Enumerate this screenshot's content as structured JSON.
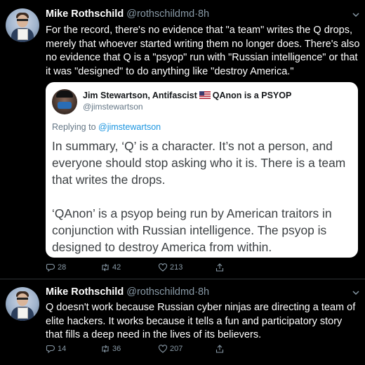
{
  "tweets": [
    {
      "author_name": "Mike Rothschild",
      "author_handle": "@rothschildmd",
      "separator": "·",
      "time": "8h",
      "text": "For the record, there's no evidence that \"a team\" writes the Q drops, merely that whoever started writing them no longer does. There's also no evidence that Q is a \"psyop\" run with \"Russian intelligence\" or that it was \"designed\" to do anything like \"destroy America.\"",
      "quoted": {
        "author_name": "Jim Stewartson, Antifascist",
        "author_suffix": "QAnon is a PSYOP",
        "author_handle": "@jimstewartson",
        "replying_label": "Replying to",
        "replying_handle": "@jimstewartson",
        "paragraphs": [
          "In summary, ‘Q’ is a character. It’s not a person, and everyone should stop asking who it is. There is a team that writes the drops.",
          "‘QAnon’ is a psyop being run by American traitors in conjunction with Russian intelligence. The psyop is designed to destroy America from within."
        ]
      },
      "actions": {
        "replies": "28",
        "retweets": "42",
        "likes": "213"
      }
    },
    {
      "author_name": "Mike Rothschild",
      "author_handle": "@rothschildmd",
      "separator": "·",
      "time": "8h",
      "text": "Q doesn't work because Russian cyber ninjas are directing a team of elite hackers. It works because it tells a fun and participatory story that fills a deep need in the lives of its believers.",
      "actions": {
        "replies": "14",
        "retweets": "36",
        "likes": "207"
      }
    }
  ],
  "icons": {
    "reply": "reply-icon",
    "retweet": "retweet-icon",
    "like": "heart-icon",
    "share": "share-icon",
    "menu": "chevron-down-icon",
    "flag": "us-flag-icon"
  },
  "colors": {
    "background": "#000000",
    "text": "#ffffff",
    "muted": "#8899a6",
    "link": "#1b95e0",
    "card": "#ffffff"
  }
}
